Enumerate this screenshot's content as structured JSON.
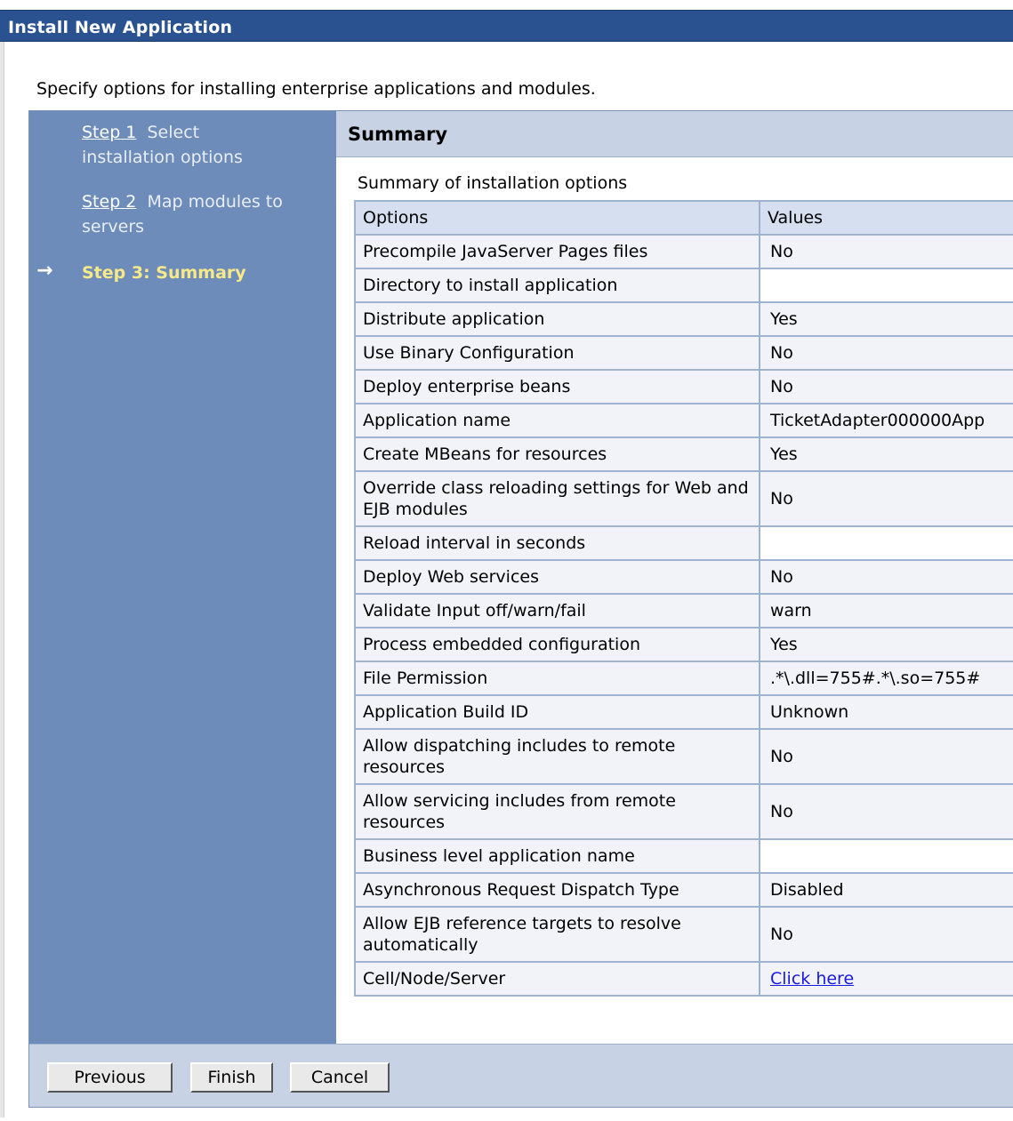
{
  "window": {
    "title": "Install New Application"
  },
  "intro": "Specify options for installing enterprise applications and modules.",
  "steps": [
    {
      "link": "Step 1",
      "text": "Select installation options"
    },
    {
      "link": "Step 2",
      "text": "Map modules to servers"
    },
    {
      "label": "Step 3: Summary",
      "current": true
    }
  ],
  "summary": {
    "heading": "Summary",
    "caption": "Summary of installation options",
    "columns": [
      "Options",
      "Values"
    ],
    "rows": [
      {
        "option": "Precompile JavaServer Pages files",
        "value": "No"
      },
      {
        "option": "Directory to install application",
        "value": ""
      },
      {
        "option": "Distribute application",
        "value": "Yes"
      },
      {
        "option": "Use Binary Configuration",
        "value": "No"
      },
      {
        "option": "Deploy enterprise beans",
        "value": "No"
      },
      {
        "option": "Application name",
        "value": "TicketAdapter000000App"
      },
      {
        "option": "Create MBeans for resources",
        "value": "Yes"
      },
      {
        "option": "Override class reloading settings for Web and EJB modules",
        "value": "No"
      },
      {
        "option": "Reload interval in seconds",
        "value": ""
      },
      {
        "option": "Deploy Web services",
        "value": "No"
      },
      {
        "option": "Validate Input off/warn/fail",
        "value": "warn"
      },
      {
        "option": "Process embedded configuration",
        "value": "Yes"
      },
      {
        "option": "File Permission",
        "value": ".*\\.dll=755#.*\\.so=755#"
      },
      {
        "option": "Application Build ID",
        "value": "Unknown"
      },
      {
        "option": "Allow dispatching includes to remote resources",
        "value": "No"
      },
      {
        "option": "Allow servicing includes from remote resources",
        "value": "No"
      },
      {
        "option": "Business level application name",
        "value": ""
      },
      {
        "option": "Asynchronous Request Dispatch Type",
        "value": "Disabled"
      },
      {
        "option": "Allow EJB reference targets to resolve automatically",
        "value": "No"
      },
      {
        "option": "Cell/Node/Server",
        "value": "Click here",
        "link": true
      }
    ]
  },
  "buttons": {
    "previous": "Previous",
    "finish": "Finish",
    "cancel": "Cancel"
  },
  "colors": {
    "titlebar": "#2a5290",
    "steps_panel": "#6d8cb9",
    "current_step": "#f7e98a",
    "header_bg": "#c7d3e4",
    "link": "#1a1ae0"
  },
  "icons": {
    "current_step": "right-arrow-icon"
  }
}
